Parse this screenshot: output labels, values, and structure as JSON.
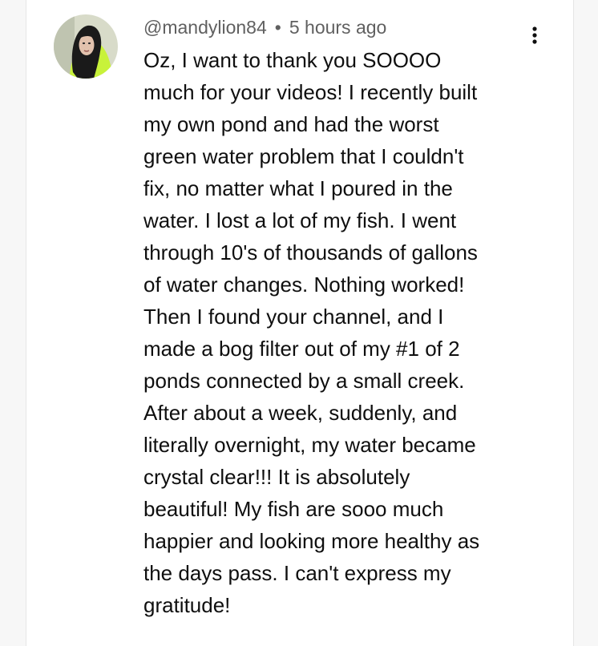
{
  "comment": {
    "author": "@mandylion84",
    "separator": "•",
    "timestamp": "5 hours ago",
    "avatar_icon": "user-avatar-photo",
    "menu_icon": "more-vertical-icon",
    "text": "Oz, I want to thank you SOOOO\nmuch for your videos! I recently built\nmy own pond and had the worst\ngreen water problem that I couldn't\nfix, no matter what I poured in the\nwater. I lost a lot of my fish. I went\nthrough 10's of thousands of gallons\nof water changes. Nothing worked!\nThen I found your channel, and I\nmade a bog filter out of my #1 of 2\nponds connected by a small creek.\nAfter about a week, suddenly, and\nliterally overnight, my water became\ncrystal clear!!! It is absolutely\nbeautiful! My fish are sooo much\nhappier and looking more healthy as\nthe days pass. I can't express my\ngratitude!"
  },
  "colors": {
    "background": "#f7f7f7",
    "card": "#ffffff",
    "text": "#0f0f0f",
    "meta": "#606060",
    "avatar_accent": "#c8f23a"
  }
}
